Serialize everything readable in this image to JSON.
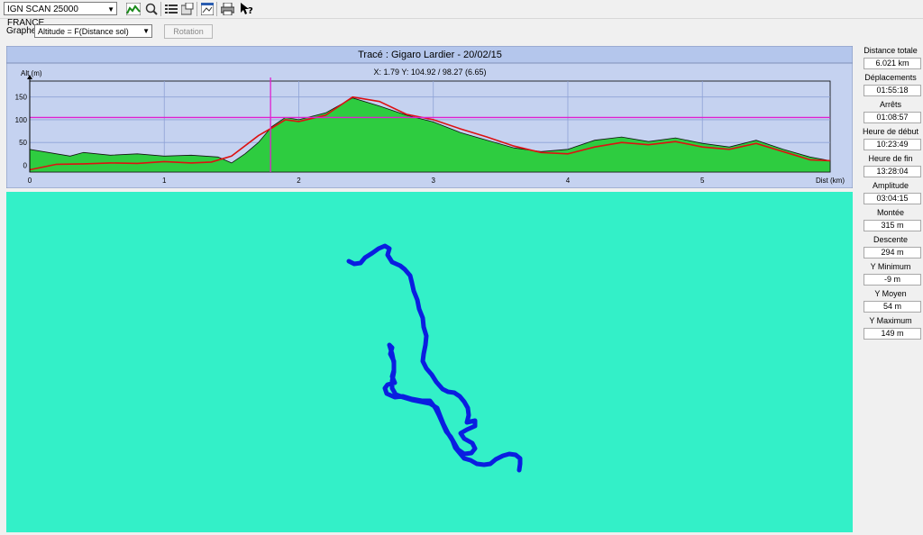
{
  "toolbar": {
    "map_select": "IGN SCAN 25000 FRANCE",
    "icons": [
      "profile-icon",
      "zoom-icon",
      "list-icon",
      "export-icon",
      "window-icon",
      "print-icon",
      "help-icon"
    ]
  },
  "graph_controls": {
    "label": "Graphe",
    "graph_type": "Altitude = F(Distance sol)",
    "rotation_label": "Rotation"
  },
  "chart": {
    "title": "Tracé : Gigaro Lardier - 20/02/15",
    "cursor_readout": "X: 1.79 Y: 104.92 / 98.27 (6.65)",
    "cursor_x": 1.79,
    "cursor_y": 104.92
  },
  "chart_data": {
    "type": "area",
    "title": "Tracé : Gigaro Lardier - 20/02/15",
    "xlabel": "Dist (km)",
    "ylabel": "Alt (m)",
    "xlim": [
      0,
      5.95
    ],
    "ylim": [
      -15,
      185
    ],
    "x_ticks": [
      0,
      1,
      2,
      3,
      4,
      5
    ],
    "y_ticks": [
      0,
      50,
      100,
      150
    ],
    "grid": true,
    "series": [
      {
        "color": "#2ecc40",
        "points": [
          [
            0,
            35
          ],
          [
            0.2,
            25
          ],
          [
            0.3,
            20
          ],
          [
            0.4,
            28
          ],
          [
            0.6,
            22
          ],
          [
            0.8,
            25
          ],
          [
            1.0,
            20
          ],
          [
            1.2,
            22
          ],
          [
            1.4,
            18
          ],
          [
            1.5,
            5
          ],
          [
            1.6,
            25
          ],
          [
            1.7,
            50
          ],
          [
            1.8,
            85
          ],
          [
            1.9,
            105
          ],
          [
            2.0,
            100
          ],
          [
            2.2,
            115
          ],
          [
            2.4,
            148
          ],
          [
            2.6,
            130
          ],
          [
            2.8,
            110
          ],
          [
            3.0,
            95
          ],
          [
            3.2,
            72
          ],
          [
            3.4,
            55
          ],
          [
            3.6,
            38
          ],
          [
            3.8,
            30
          ],
          [
            4.0,
            35
          ],
          [
            4.2,
            55
          ],
          [
            4.4,
            62
          ],
          [
            4.6,
            52
          ],
          [
            4.8,
            60
          ],
          [
            5.0,
            48
          ],
          [
            5.2,
            40
          ],
          [
            5.4,
            55
          ],
          [
            5.6,
            35
          ],
          [
            5.8,
            18
          ],
          [
            5.95,
            10
          ]
        ]
      },
      {
        "color": "#dd1111",
        "points": [
          [
            0,
            -10
          ],
          [
            0.2,
            2
          ],
          [
            0.4,
            3
          ],
          [
            0.6,
            5
          ],
          [
            0.8,
            4
          ],
          [
            1.0,
            8
          ],
          [
            1.2,
            5
          ],
          [
            1.35,
            7
          ],
          [
            1.5,
            20
          ],
          [
            1.7,
            65
          ],
          [
            1.8,
            82
          ],
          [
            1.9,
            100
          ],
          [
            2.0,
            96
          ],
          [
            2.2,
            110
          ],
          [
            2.4,
            150
          ],
          [
            2.6,
            140
          ],
          [
            2.8,
            112
          ],
          [
            3.0,
            100
          ],
          [
            3.2,
            80
          ],
          [
            3.4,
            62
          ],
          [
            3.6,
            42
          ],
          [
            3.8,
            28
          ],
          [
            4.0,
            25
          ],
          [
            4.2,
            40
          ],
          [
            4.4,
            50
          ],
          [
            4.6,
            45
          ],
          [
            4.8,
            52
          ],
          [
            5.0,
            40
          ],
          [
            5.2,
            35
          ],
          [
            5.4,
            48
          ],
          [
            5.6,
            30
          ],
          [
            5.8,
            12
          ],
          [
            5.95,
            10
          ]
        ]
      }
    ],
    "reference_line": 104.92
  },
  "track": {
    "color": "#0a1ee0"
  },
  "stats": [
    {
      "label": "Distance totale",
      "value": "6.021 km"
    },
    {
      "label": "Déplacements",
      "value": "01:55:18"
    },
    {
      "label": "Arrêts",
      "value": "01:08:57"
    },
    {
      "label": "Heure de début",
      "value": "10:23:49"
    },
    {
      "label": "Heure de fin",
      "value": "13:28:04"
    },
    {
      "label": "Amplitude",
      "value": "03:04:15"
    },
    {
      "label": "Montée",
      "value": "315 m"
    },
    {
      "label": "Descente",
      "value": "294 m"
    },
    {
      "label": "Y Minimum",
      "value": "-9 m"
    },
    {
      "label": "Y Moyen",
      "value": "54 m"
    },
    {
      "label": "Y Maximum",
      "value": "149 m"
    }
  ]
}
